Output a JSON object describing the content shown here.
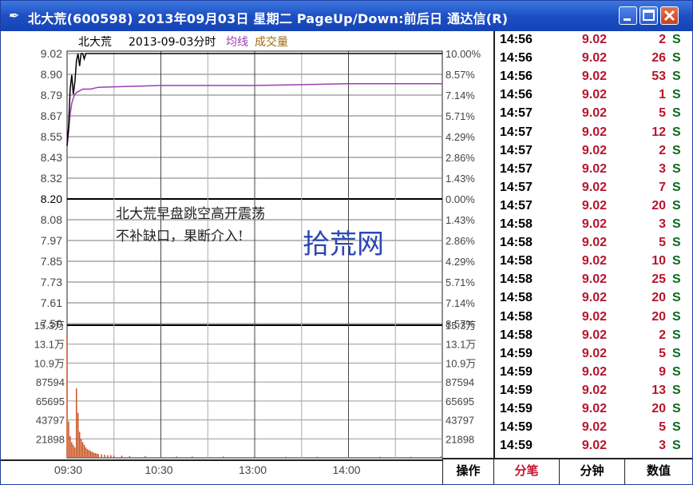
{
  "window": {
    "title": "北大荒(600598) 2013年09月03日 星期二 PageUp/Down:前后日 通达信(R)",
    "title_icon": "pen-icon"
  },
  "chart_header": {
    "name": "北大荒",
    "datetime": "2013-09-03分时",
    "avg_label": "均线",
    "vol_label": "成交量"
  },
  "annotation": {
    "line1": "北大荒早盘跳空高开震荡",
    "line2": "不补缺口，果断介入!"
  },
  "watermark": "拾荒网",
  "colors": {
    "price_line": "#000000",
    "avg_line": "#9a3fb0",
    "volume_bar": "#c8501e",
    "tick_price": "#b8152b",
    "tick_sell": "#0b6b1c",
    "title_bar": "#1d4fc4"
  },
  "chart_data": [
    {
      "type": "line",
      "title": "",
      "x_ticks": [
        "09:30",
        "10:30",
        "13:00",
        "14:00"
      ],
      "y_ticks_left": [
        "9.02",
        "8.90",
        "8.79",
        "8.67",
        "8.55",
        "8.43",
        "8.32",
        "8.20",
        "8.08",
        "7.97",
        "7.85",
        "7.73",
        "7.61",
        "7.50"
      ],
      "y_ticks_right": [
        "10.00%",
        "8.57%",
        "7.14%",
        "5.71%",
        "4.29%",
        "2.86%",
        "1.43%",
        "0.00%",
        "1.43%",
        "2.86%",
        "4.29%",
        "5.71%",
        "7.14%",
        "8.57%"
      ],
      "ylim": [
        7.5,
        9.02
      ],
      "prev_close": 8.2,
      "grid": true,
      "series": [
        {
          "name": "",
          "x": [
            0,
            1,
            2,
            3,
            4,
            5,
            6,
            7,
            8,
            9,
            10,
            11,
            12,
            14,
            240
          ],
          "values": [
            8.5,
            8.62,
            8.82,
            8.9,
            8.79,
            8.86,
            8.98,
            9.02,
            8.95,
            9.02,
            9.02,
            8.99,
            9.02,
            9.02,
            9.02
          ]
        },
        {
          "name": "均线",
          "x": [
            0,
            1,
            2,
            3,
            4,
            5,
            6,
            8,
            10,
            15,
            20,
            60,
            120,
            180,
            240
          ],
          "values": [
            8.5,
            8.58,
            8.68,
            8.74,
            8.77,
            8.79,
            8.8,
            8.81,
            8.82,
            8.82,
            8.83,
            8.84,
            8.84,
            8.85,
            8.85
          ]
        }
      ]
    },
    {
      "type": "bar",
      "title": "成交量",
      "y_ticks": [
        "15.3万",
        "13.1万",
        "10.9万",
        "87594",
        "65695",
        "43797",
        "21898"
      ],
      "ylim": [
        0,
        153000
      ],
      "x": [
        0,
        1,
        2,
        3,
        4,
        5,
        6,
        7,
        8,
        9,
        10,
        11,
        12,
        13,
        14,
        15,
        16,
        17,
        18,
        19,
        20,
        22,
        24,
        26,
        28,
        30,
        35,
        40,
        50,
        60,
        70,
        80,
        100,
        120,
        140,
        160,
        180,
        200,
        220,
        239
      ],
      "values": [
        140000,
        42000,
        25000,
        18000,
        15000,
        12000,
        80000,
        52000,
        30000,
        22000,
        18000,
        15000,
        12000,
        10000,
        9000,
        8000,
        7000,
        6000,
        5500,
        5000,
        4500,
        4000,
        3500,
        3000,
        3000,
        2500,
        2500,
        2000,
        2000,
        1800,
        1500,
        1500,
        1500,
        1500,
        1200,
        1200,
        1200,
        1200,
        1200,
        1500
      ]
    }
  ],
  "ticks": [
    {
      "time": "14:56",
      "price": "9.02",
      "vol": "2",
      "side": "S"
    },
    {
      "time": "14:56",
      "price": "9.02",
      "vol": "26",
      "side": "S"
    },
    {
      "time": "14:56",
      "price": "9.02",
      "vol": "53",
      "side": "S"
    },
    {
      "time": "14:56",
      "price": "9.02",
      "vol": "1",
      "side": "S"
    },
    {
      "time": "14:57",
      "price": "9.02",
      "vol": "5",
      "side": "S"
    },
    {
      "time": "14:57",
      "price": "9.02",
      "vol": "12",
      "side": "S"
    },
    {
      "time": "14:57",
      "price": "9.02",
      "vol": "2",
      "side": "S"
    },
    {
      "time": "14:57",
      "price": "9.02",
      "vol": "3",
      "side": "S"
    },
    {
      "time": "14:57",
      "price": "9.02",
      "vol": "7",
      "side": "S"
    },
    {
      "time": "14:57",
      "price": "9.02",
      "vol": "20",
      "side": "S"
    },
    {
      "time": "14:58",
      "price": "9.02",
      "vol": "3",
      "side": "S"
    },
    {
      "time": "14:58",
      "price": "9.02",
      "vol": "5",
      "side": "S"
    },
    {
      "time": "14:58",
      "price": "9.02",
      "vol": "10",
      "side": "S"
    },
    {
      "time": "14:58",
      "price": "9.02",
      "vol": "25",
      "side": "S"
    },
    {
      "time": "14:58",
      "price": "9.02",
      "vol": "20",
      "side": "S"
    },
    {
      "time": "14:58",
      "price": "9.02",
      "vol": "20",
      "side": "S"
    },
    {
      "time": "14:58",
      "price": "9.02",
      "vol": "2",
      "side": "S"
    },
    {
      "time": "14:59",
      "price": "9.02",
      "vol": "5",
      "side": "S"
    },
    {
      "time": "14:59",
      "price": "9.02",
      "vol": "9",
      "side": "S"
    },
    {
      "time": "14:59",
      "price": "9.02",
      "vol": "13",
      "side": "S"
    },
    {
      "time": "14:59",
      "price": "9.02",
      "vol": "20",
      "side": "S"
    },
    {
      "time": "14:59",
      "price": "9.02",
      "vol": "5",
      "side": "S"
    },
    {
      "time": "14:59",
      "price": "9.02",
      "vol": "3",
      "side": "S"
    }
  ],
  "tabs": [
    "操作",
    "分笔",
    "分钟",
    "数值"
  ]
}
